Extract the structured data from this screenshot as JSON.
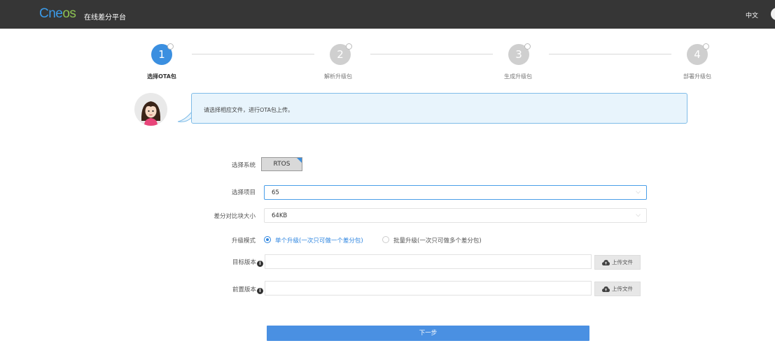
{
  "header": {
    "logo_main": "Cne",
    "logo_os": "os",
    "platform_title": "在线差分平台",
    "language": "中文"
  },
  "steps": [
    {
      "number": "1",
      "label": "选择OTA包",
      "active": true
    },
    {
      "number": "2",
      "label": "解析升级包",
      "active": false
    },
    {
      "number": "3",
      "label": "生成升级包",
      "active": false
    },
    {
      "number": "4",
      "label": "部署升级包",
      "active": false
    }
  ],
  "tip": {
    "text": "请选择相应文件，进行OTA包上传。"
  },
  "form": {
    "system_label": "选择系统",
    "system_value": "RTOS",
    "project_label": "选择项目",
    "project_value": "65",
    "block_label": "差分对比块大小",
    "block_value": "64KB",
    "mode_label": "升级模式",
    "mode_options": [
      "单个升级(一次只可做一个差分包)",
      "批量升级(一次只可做多个差分包)"
    ],
    "mode_selected": 0,
    "target_label": "目标版本",
    "pre_label": "前置版本",
    "upload_label": "上传文件",
    "info_glyph": "i"
  },
  "actions": {
    "next_label": "下一步"
  },
  "colors": {
    "accent": "#4a90e2",
    "topbar": "#363636",
    "logo_blue": "#3b9ae8",
    "logo_green": "#8cc152",
    "bubble_bg": "#e8f4fc"
  }
}
